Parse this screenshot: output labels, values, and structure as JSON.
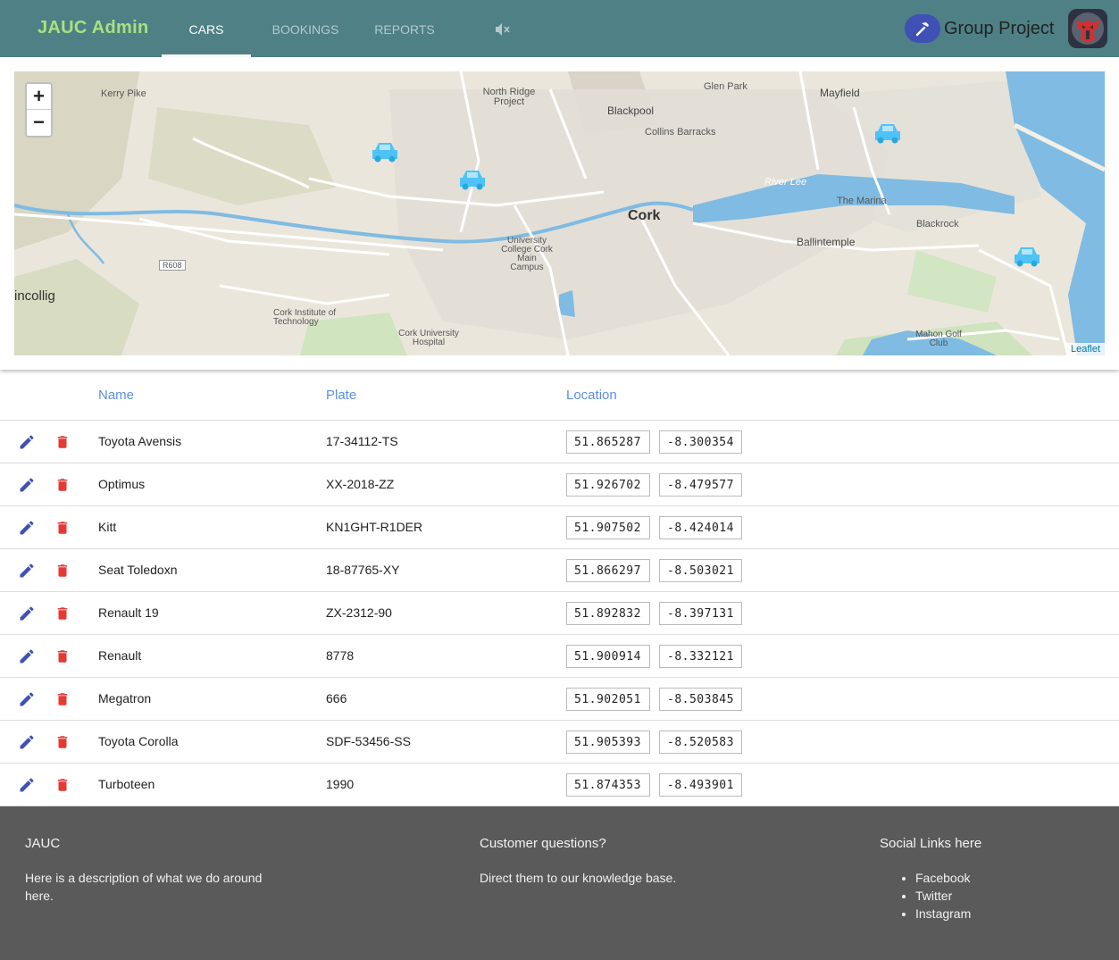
{
  "header": {
    "brand": "JAUC Admin",
    "tabs": [
      {
        "label": "Cars",
        "active": true
      },
      {
        "label": "Bookings",
        "active": false
      },
      {
        "label": "Reports",
        "active": false
      }
    ],
    "mute_icon": "volume-off-icon",
    "project_icon": "hammer-icon",
    "project_name": "Group Project",
    "avatar_icon": "autobot-avatar"
  },
  "map": {
    "zoom_in": "+",
    "zoom_out": "−",
    "attribution": "Leaflet",
    "labels": {
      "cork": "Cork",
      "blackpool": "Blackpool",
      "mayfield": "Mayfield",
      "glen_park": "Glen Park",
      "collins": "Collins Barracks",
      "kerry_pike": "Kerry Pike",
      "north_ridge": "North Ridge Project",
      "ballintemple": "Ballintemple",
      "blackrock": "Blackrock",
      "marina": "The Marina",
      "ucc": "University College Cork Main Campus",
      "cit": "Cork Institute of Technology",
      "cuh": "Cork University Hospital",
      "mahon": "Mahon Golf Club",
      "ballincollig": "incollig",
      "river_lee": "River Lee",
      "r608": "R608"
    },
    "car_icon": "car-marker-icon"
  },
  "table": {
    "headers": {
      "name": "Name",
      "plate": "Plate",
      "location": "Location"
    },
    "rows": [
      {
        "name": "Toyota Avensis",
        "plate": "17-34112-TS",
        "lat": "51.865287",
        "lng": "-8.300354"
      },
      {
        "name": "Optimus",
        "plate": "XX-2018-ZZ",
        "lat": "51.926702",
        "lng": "-8.479577"
      },
      {
        "name": "Kitt",
        "plate": "KN1GHT-R1DER",
        "lat": "51.907502",
        "lng": "-8.424014"
      },
      {
        "name": "Seat Toledoxn",
        "plate": "18-87765-XY",
        "lat": "51.866297",
        "lng": "-8.503021"
      },
      {
        "name": "Renault 19",
        "plate": "ZX-2312-90",
        "lat": "51.892832",
        "lng": "-8.397131"
      },
      {
        "name": "Renault",
        "plate": "8778",
        "lat": "51.900914",
        "lng": "-8.332121"
      },
      {
        "name": "Megatron",
        "plate": "666",
        "lat": "51.902051",
        "lng": "-8.503845"
      },
      {
        "name": "Toyota Corolla",
        "plate": "SDF-53456-SS",
        "lat": "51.905393",
        "lng": "-8.520583"
      },
      {
        "name": "Turboteen",
        "plate": "1990",
        "lat": "51.874353",
        "lng": "-8.493901"
      }
    ]
  },
  "footer": {
    "about_title": "JAUC",
    "about_text": "Here is a description of what we do around here.",
    "questions_title": "Customer questions?",
    "questions_text": "Direct them to our knowledge base.",
    "social_title": "Social Links here",
    "social_links": [
      "Facebook",
      "Twitter",
      "Instagram"
    ]
  },
  "colors": {
    "topbar": "#4e8086",
    "brand": "#a7e27d",
    "accent": "#3f51b5",
    "header_text": "#5c8fe0",
    "delete": "#e53935",
    "footer": "#5a5a5a",
    "marker": "#4fc3f7"
  }
}
